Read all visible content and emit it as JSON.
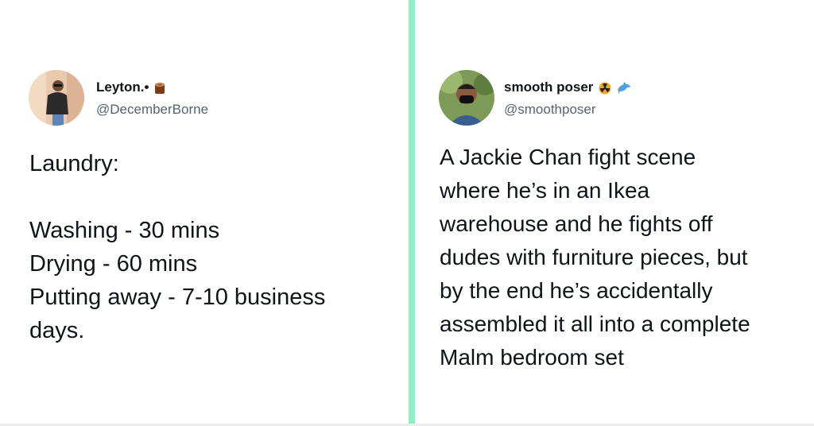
{
  "left_tweet": {
    "display_name": "Leyton.•",
    "handle": "@DecemberBorne",
    "name_emoji_icon": "wood-log-icon",
    "text_lines": [
      "Laundry:",
      "",
      "Washing - 30 mins",
      "Drying - 60 mins",
      "Putting away - 7-10 business",
      "days."
    ]
  },
  "right_tweet": {
    "display_name": "smooth poser",
    "handle": "@smoothposer",
    "name_emoji_icons": [
      "radioactive-icon",
      "dolphin-icon"
    ],
    "text_lines": [
      "A Jackie Chan fight scene",
      "where he’s in an Ikea",
      "warehouse and he fights off",
      "dudes with furniture pieces, but",
      "by the end he’s accidentally",
      "assembled it all into a complete",
      "Malm bedroom set"
    ]
  },
  "colors": {
    "divider": "#8ef0c4",
    "handle": "#536471",
    "text": "#0f1419"
  }
}
